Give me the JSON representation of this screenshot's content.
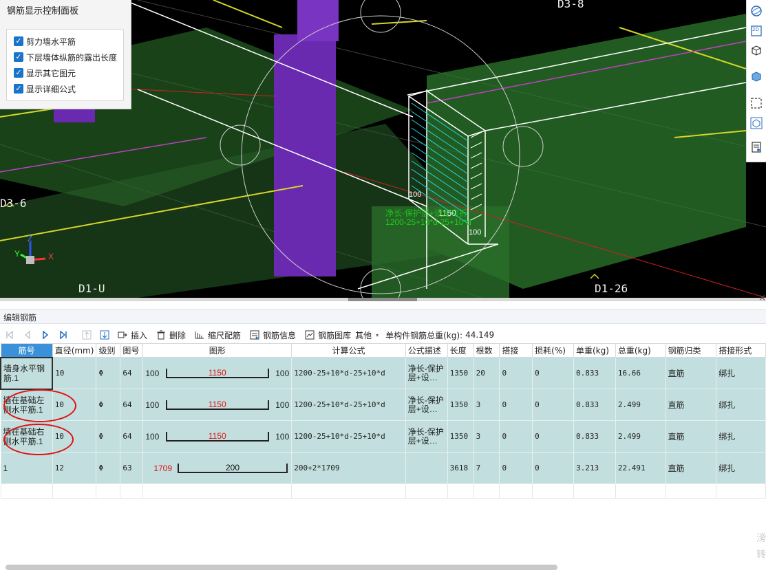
{
  "control_panel": {
    "title": "钢筋显示控制面板",
    "options": [
      {
        "label": "剪力墙水平筋",
        "checked": true
      },
      {
        "label": "下层墙体纵筋的露出长度",
        "checked": true
      },
      {
        "label": "显示其它图元",
        "checked": true
      },
      {
        "label": "显示详细公式",
        "checked": true
      }
    ]
  },
  "viewport": {
    "axis_labels": {
      "top": "D3-8",
      "left": "D3-6",
      "bottom_left": "D1-U",
      "bottom_right": "D1-26"
    },
    "gizmo": {
      "z": "Z",
      "y": "Y",
      "x": "X"
    },
    "dims": {
      "left": "100",
      "middle": "1150",
      "right": "100"
    },
    "formula_overlay": [
      "净长-保护层+设定弯折",
      "1200-25+10*d-25+10*d"
    ]
  },
  "right_toolbar": {
    "icons": [
      "sphere-view-icon",
      "2d-view-icon",
      "3d-box-icon",
      "solid-box-icon",
      "dashed-select-icon",
      "dynamic-view-icon",
      "report-icon"
    ],
    "btn_2d": "2D"
  },
  "panel": {
    "title": "编辑钢筋",
    "close": "×"
  },
  "toolbar": {
    "insert": "插入",
    "delete": "删除",
    "scale_config": "缩尺配筋",
    "rebar_info": "钢筋信息",
    "rebar_library": "钢筋图库",
    "other": "其他",
    "total_weight_label": "单构件钢筋总重(kg):",
    "total_weight_value": "44.149"
  },
  "columns": [
    "筋号",
    "直径(mm)",
    "级别",
    "图号",
    "图形",
    "计算公式",
    "公式描述",
    "长度",
    "根数",
    "搭接",
    "损耗(%)",
    "单重(kg)",
    "总重(kg)",
    "钢筋归类",
    "搭接形式"
  ],
  "rows": [
    {
      "name": "墙身水平钢筋.1",
      "diameter": "10",
      "grade": "Φ",
      "fig_no": "64",
      "shape_left": "100",
      "shape_mid": "1150",
      "shape_right": "100",
      "formula": "1200-25+10*d-25+10*d",
      "desc": "净长-保护层+设…",
      "length": "1350",
      "count": "20",
      "lap": "0",
      "loss": "0",
      "unit_wt": "0.833",
      "total_wt": "16.66",
      "category": "直筋",
      "lap_type": "绑扎"
    },
    {
      "name": "墙在基础左侧水平筋.1",
      "diameter": "10",
      "grade": "Φ",
      "fig_no": "64",
      "shape_left": "100",
      "shape_mid": "1150",
      "shape_right": "100",
      "formula": "1200-25+10*d-25+10*d",
      "desc": "净长-保护层+设…",
      "length": "1350",
      "count": "3",
      "lap": "0",
      "loss": "0",
      "unit_wt": "0.833",
      "total_wt": "2.499",
      "category": "直筋",
      "lap_type": "绑扎"
    },
    {
      "name": "墙在基础右侧水平筋.1",
      "diameter": "10",
      "grade": "Φ",
      "fig_no": "64",
      "shape_left": "100",
      "shape_mid": "1150",
      "shape_right": "100",
      "formula": "1200-25+10*d-25+10*d",
      "desc": "净长-保护层+设…",
      "length": "1350",
      "count": "3",
      "lap": "0",
      "loss": "0",
      "unit_wt": "0.833",
      "total_wt": "2.499",
      "category": "直筋",
      "lap_type": "绑扎"
    },
    {
      "name": "1",
      "diameter": "12",
      "grade": "Φ",
      "fig_no": "63",
      "shape_left": "1709",
      "shape_mid": "200",
      "shape_right": "",
      "formula": "200+2*1709",
      "desc": "",
      "length": "3618",
      "count": "7",
      "lap": "0",
      "loss": "0",
      "unit_wt": "3.213",
      "total_wt": "22.491",
      "category": "直筋",
      "lap_type": "绑扎"
    }
  ],
  "watermark": [
    "滂",
    "转"
  ]
}
